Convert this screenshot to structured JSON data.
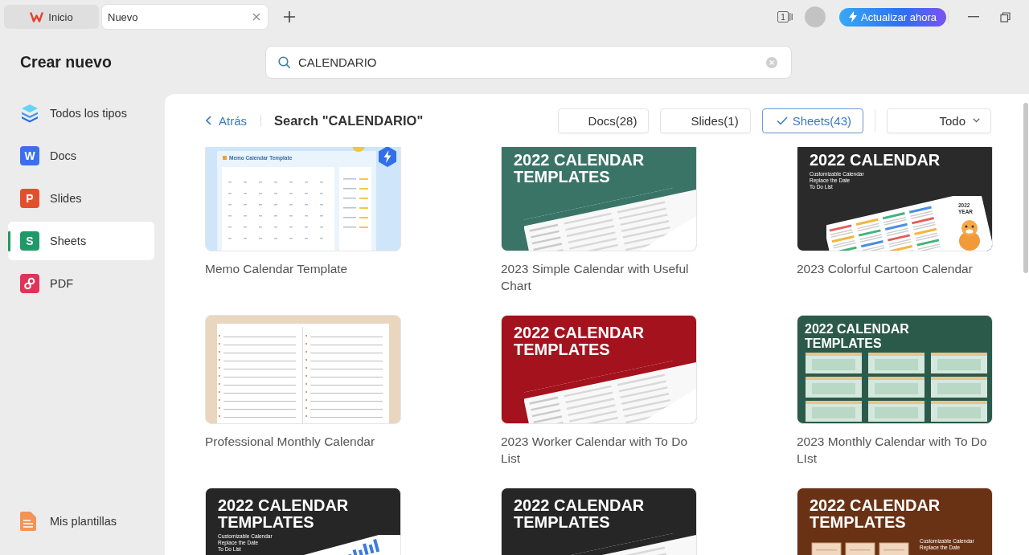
{
  "tabs": [
    {
      "label": "Inicio",
      "kind": "home",
      "selected": false
    },
    {
      "label": "Nuevo",
      "kind": "document",
      "selected": true
    }
  ],
  "toolbar": {
    "window_count": "1",
    "upgrade_button": "Actualizar ahora"
  },
  "title": "Crear nuevo",
  "search": {
    "value": "CALENDARIO"
  },
  "sidebar": {
    "items": [
      {
        "label": "Todos los tipos",
        "kind": "all",
        "selected": false
      },
      {
        "label": "Docs",
        "kind": "docs",
        "badge": "W",
        "selected": false
      },
      {
        "label": "Slides",
        "kind": "slides",
        "badge": "P",
        "selected": false
      },
      {
        "label": "Sheets",
        "kind": "sheets",
        "badge": "S",
        "selected": true
      },
      {
        "label": "PDF",
        "kind": "pdf",
        "selected": false
      }
    ],
    "footer": {
      "label": "Mis plantillas",
      "kind": "templates"
    }
  },
  "results": {
    "back_link": "Atrás",
    "heading": "Search \"CALENDARIO\"",
    "filters": [
      {
        "label": "Docs(28)",
        "selected": false
      },
      {
        "label": "Slides(1)",
        "selected": false
      },
      {
        "label": "Sheets(43)",
        "selected": true
      }
    ],
    "sort": "Todo",
    "templates": [
      {
        "title": "Memo Calendar Template",
        "kind": "memo",
        "color": "#cfe5f9",
        "heading": [
          "Memo Calendar Template"
        ],
        "premium": true
      },
      {
        "title": "2023 Simple Calendar with Useful Chart",
        "kind": "tilted",
        "color": "#3a7466",
        "heading": [
          "2022 CALENDAR",
          "TEMPLATES"
        ],
        "premium": false
      },
      {
        "title": "2023 Colorful Cartoon Calendar",
        "kind": "cartoon",
        "color": "#2a2a2a",
        "heading": [
          "2022 CALENDAR"
        ],
        "notes": [
          "Customizable Calendar",
          "Replace the Date",
          "To Do List"
        ],
        "label": [
          "2022",
          "YEAR"
        ],
        "premium": false
      },
      {
        "title": "Professional Monthly Calendar",
        "kind": "lined",
        "color": "#ead5bf",
        "premium": false
      },
      {
        "title": "2023 Worker Calendar with To Do List",
        "kind": "tilted",
        "color": "#a3121d",
        "heading": [
          "2022 CALENDAR",
          "TEMPLATES"
        ],
        "premium": false
      },
      {
        "title": "2023 Monthly Calendar with To Do LIst",
        "kind": "grid",
        "color": "#2c5a4a",
        "heading": [
          "2022 CALENDAR",
          "TEMPLATES"
        ],
        "premium": false
      },
      {
        "kind": "charts",
        "color": "#262626",
        "heading": [
          "2022 CALENDAR",
          "TEMPLATES"
        ],
        "notes": [
          "Customizable Calendar",
          "Replace the Date",
          "To Do List"
        ],
        "premium": false
      },
      {
        "kind": "tilted",
        "color": "#262626",
        "heading": [
          "2022 CALENDAR",
          "TEMPLATES"
        ],
        "premium": false
      },
      {
        "kind": "pages",
        "color": "#6a3215",
        "heading": [
          "2022 CALENDAR",
          "TEMPLATES"
        ],
        "notes": [
          "Customizable Calendar",
          "Replace the Date"
        ],
        "premium": false
      }
    ]
  }
}
